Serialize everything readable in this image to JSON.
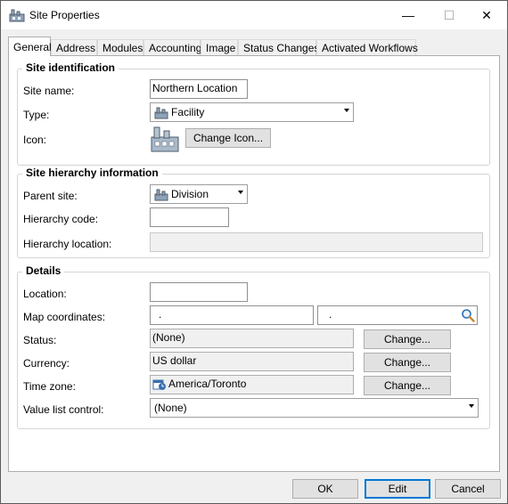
{
  "window": {
    "title": "Site Properties",
    "min_glyph": "—",
    "max_glyph": "☐",
    "close_glyph": "✕"
  },
  "tabs": [
    "General",
    "Address",
    "Modules",
    "Accounting",
    "Image",
    "Status Changes",
    "Activated Workflows"
  ],
  "site_identification": {
    "title": "Site identification",
    "site_name_label": "Site name:",
    "site_name_value": "Northern Location",
    "type_label": "Type:",
    "type_value": "Facility",
    "icon_label": "Icon:",
    "change_icon_button": "Change Icon..."
  },
  "site_hierarchy": {
    "title": "Site hierarchy information",
    "parent_site_label": "Parent site:",
    "parent_site_value": "Division",
    "hierarchy_code_label": "Hierarchy code:",
    "hierarchy_code_value": "",
    "hierarchy_location_label": "Hierarchy location:",
    "hierarchy_location_value": ""
  },
  "details": {
    "title": "Details",
    "location_label": "Location:",
    "location_value": "",
    "map_coordinates_label": "Map coordinates:",
    "map_lat_value": ".",
    "map_lon_value": ".",
    "status_label": "Status:",
    "status_value": "(None)",
    "currency_label": "Currency:",
    "currency_value": "US dollar",
    "time_zone_label": "Time zone:",
    "time_zone_value": "America/Toronto",
    "value_list_control_label": "Value list control:",
    "value_list_control_value": "(None)",
    "change_button": "Change..."
  },
  "footer": {
    "ok": "OK",
    "edit": "Edit",
    "cancel": "Cancel"
  },
  "colors": {
    "focus_border": "#0078d7",
    "panel_bg": "#ffffff",
    "window_bg": "#f0f0f0"
  }
}
